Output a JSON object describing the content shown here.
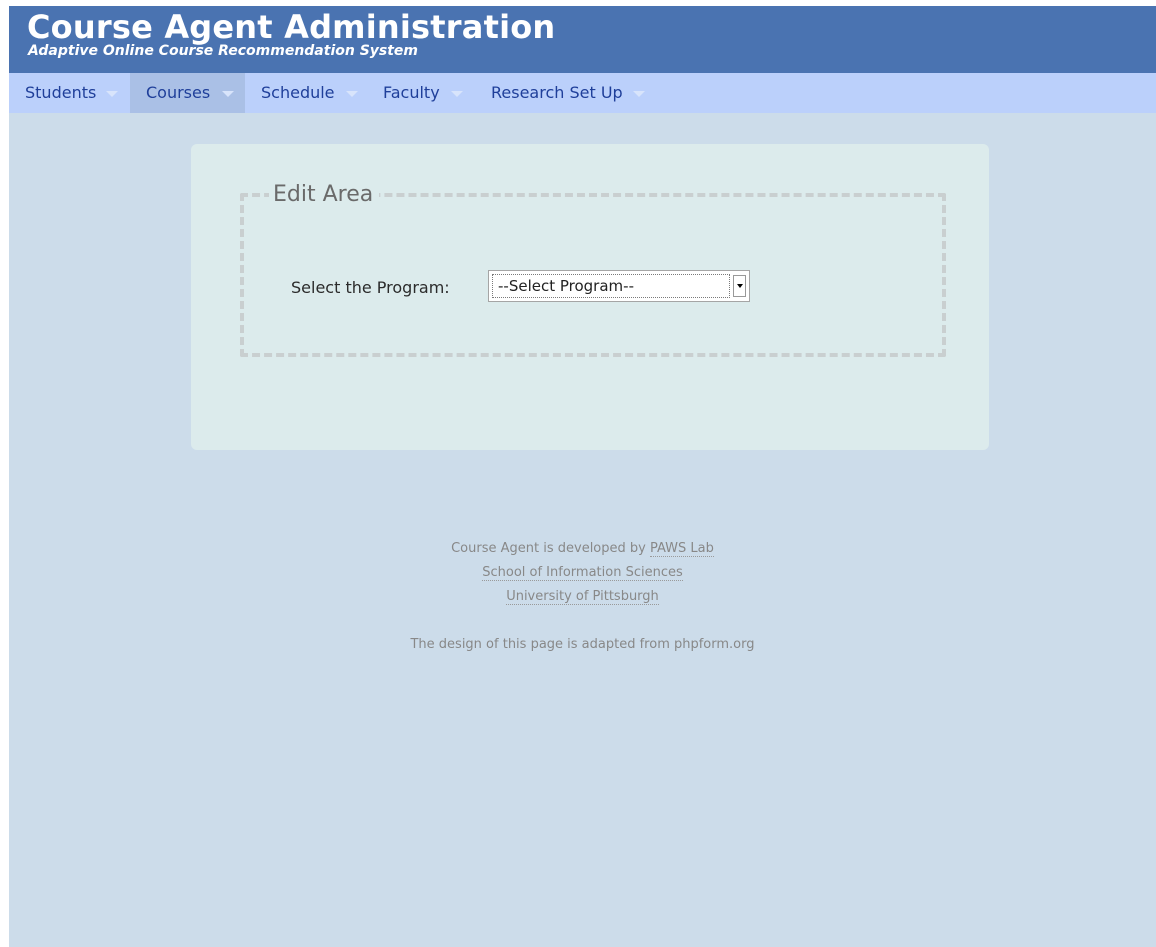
{
  "header": {
    "title": "Course Agent Administration",
    "subtitle": "Adaptive Online Course Recommendation System"
  },
  "nav": {
    "items": [
      {
        "label": "Students",
        "active": false
      },
      {
        "label": "Courses",
        "active": true
      },
      {
        "label": "Schedule",
        "active": false
      },
      {
        "label": "Faculty",
        "active": false
      },
      {
        "label": "Research Set Up",
        "active": false
      }
    ]
  },
  "form": {
    "legend": "Edit Area",
    "program_label": "Select the Program:",
    "program_selected": "--Select Program--"
  },
  "footer": {
    "developed_by_text": "Course Agent is developed by",
    "paws_link": "PAWS Lab",
    "school_link": "School of Information Sciences",
    "university_link": "University of Pittsburgh",
    "design_note": "The design of this page is adapted from phpform.org"
  },
  "colors": {
    "header_bg": "#4a73b1",
    "nav_bg": "#bbd0fb",
    "nav_active_bg": "#aac0e6",
    "page_bg": "#ccdcea",
    "panel_bg": "#dcebec"
  }
}
